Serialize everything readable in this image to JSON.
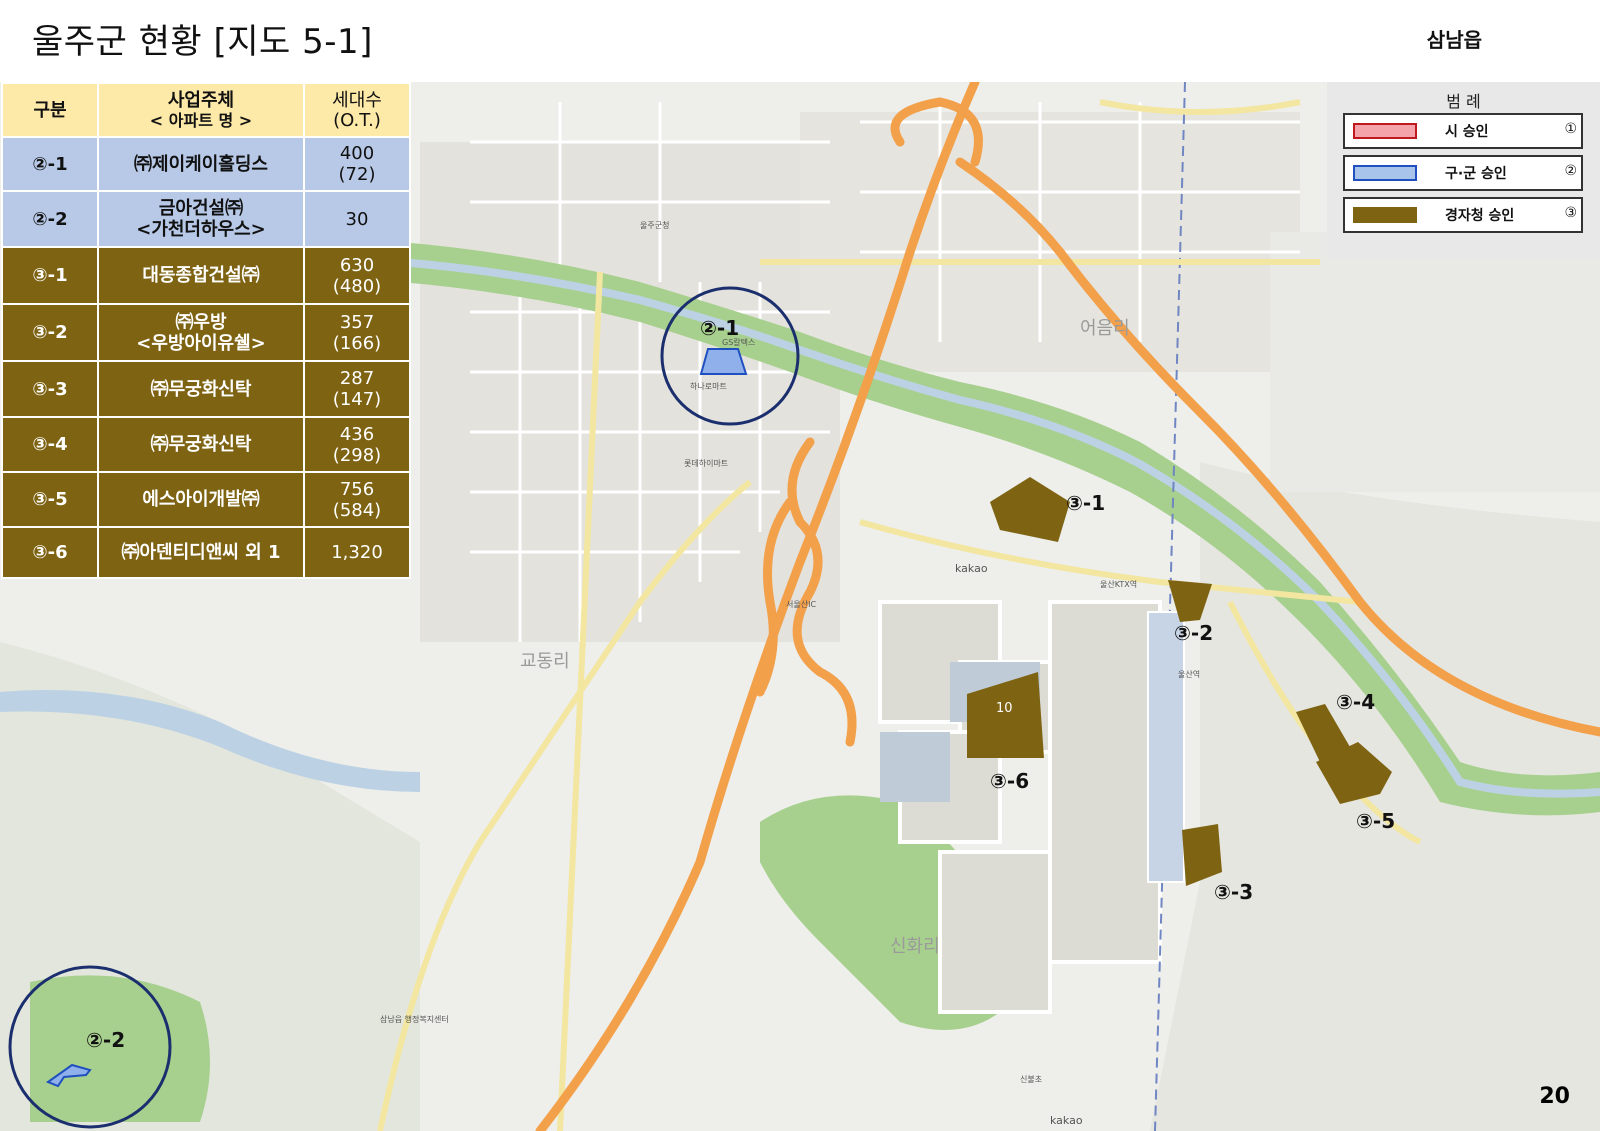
{
  "page": {
    "title": "울주군 현황 [지도 5-1]",
    "region": "삼남읍",
    "page_number": "20"
  },
  "table": {
    "headers": {
      "col1": "구분",
      "col2_line1": "사업주체",
      "col2_line2": "< 아파트 명 >",
      "col3_line1": "세대수",
      "col3_line2": "(O.T.)"
    },
    "rows": [
      {
        "id": "②-1",
        "name1": "㈜제이케이홀딩스",
        "name2": "",
        "units1": "400",
        "units2": "(72)",
        "group": "gu"
      },
      {
        "id": "②-2",
        "name1": "금아건설㈜",
        "name2": "<가천더하우스>",
        "units1": "30",
        "units2": "",
        "group": "gu"
      },
      {
        "id": "③-1",
        "name1": "대동종합건설㈜",
        "name2": "",
        "units1": "630",
        "units2": "(480)",
        "group": "fez"
      },
      {
        "id": "③-2",
        "name1": "㈜우방",
        "name2": "<우방아이유쉘>",
        "units1": "357",
        "units2": "(166)",
        "group": "fez"
      },
      {
        "id": "③-3",
        "name1": "㈜무궁화신탁",
        "name2": "",
        "units1": "287",
        "units2": "(147)",
        "group": "fez"
      },
      {
        "id": "③-4",
        "name1": "㈜무궁화신탁",
        "name2": "",
        "units1": "436",
        "units2": "(298)",
        "group": "fez"
      },
      {
        "id": "③-5",
        "name1": "에스아이개발㈜",
        "name2": "",
        "units1": "756",
        "units2": "(584)",
        "group": "fez"
      },
      {
        "id": "③-6",
        "name1": "㈜아덴티디앤씨 외 1",
        "name2": "",
        "units1": "1,320",
        "units2": "",
        "group": "fez"
      }
    ]
  },
  "legend": {
    "title": "범 례",
    "items": [
      {
        "label": "시 승인",
        "key": "①",
        "fill": "#f4a3aa",
        "border": "#c0181f"
      },
      {
        "label": "구·군 승인",
        "key": "②",
        "fill": "#a9c4ea",
        "border": "#2050c0"
      },
      {
        "label": "경자청 승인",
        "key": "③",
        "fill": "#7e6312",
        "border": "#7e6312"
      }
    ]
  },
  "map": {
    "colors": {
      "base": "#eeeeea",
      "green": "#a7d08e",
      "water": "#bcd2e4",
      "highway": "#f2a04a",
      "road": "#f3e6a0",
      "approved_gu": "#8fb0ea",
      "approved_fez": "#7e6312",
      "circle": "#1b2f6e"
    },
    "parcel_labels": {
      "p2_1": "②-1",
      "p2_2": "②-2",
      "p3_1": "③-1",
      "p3_2": "③-2",
      "p3_3": "③-3",
      "p3_4": "③-4",
      "p3_5": "③-5",
      "p3_6": "③-6",
      "block_no": "10"
    },
    "place_labels": {
      "eonyang": "어음리",
      "gyodong": "교동리",
      "sinhwa": "신화리",
      "kakao1": "kakao",
      "kakao2": "kakao",
      "gs_caltex": "GS칼텍스",
      "hanaro": "하나로마트",
      "lotte": "롯데하이마트",
      "ulju_office": "울주군청",
      "station": "울산역",
      "ktx": "울산KTX역",
      "samnam_office": "삼남읍 행정복지센터",
      "seobu": "서울산IC",
      "sinbul": "신불초"
    }
  }
}
